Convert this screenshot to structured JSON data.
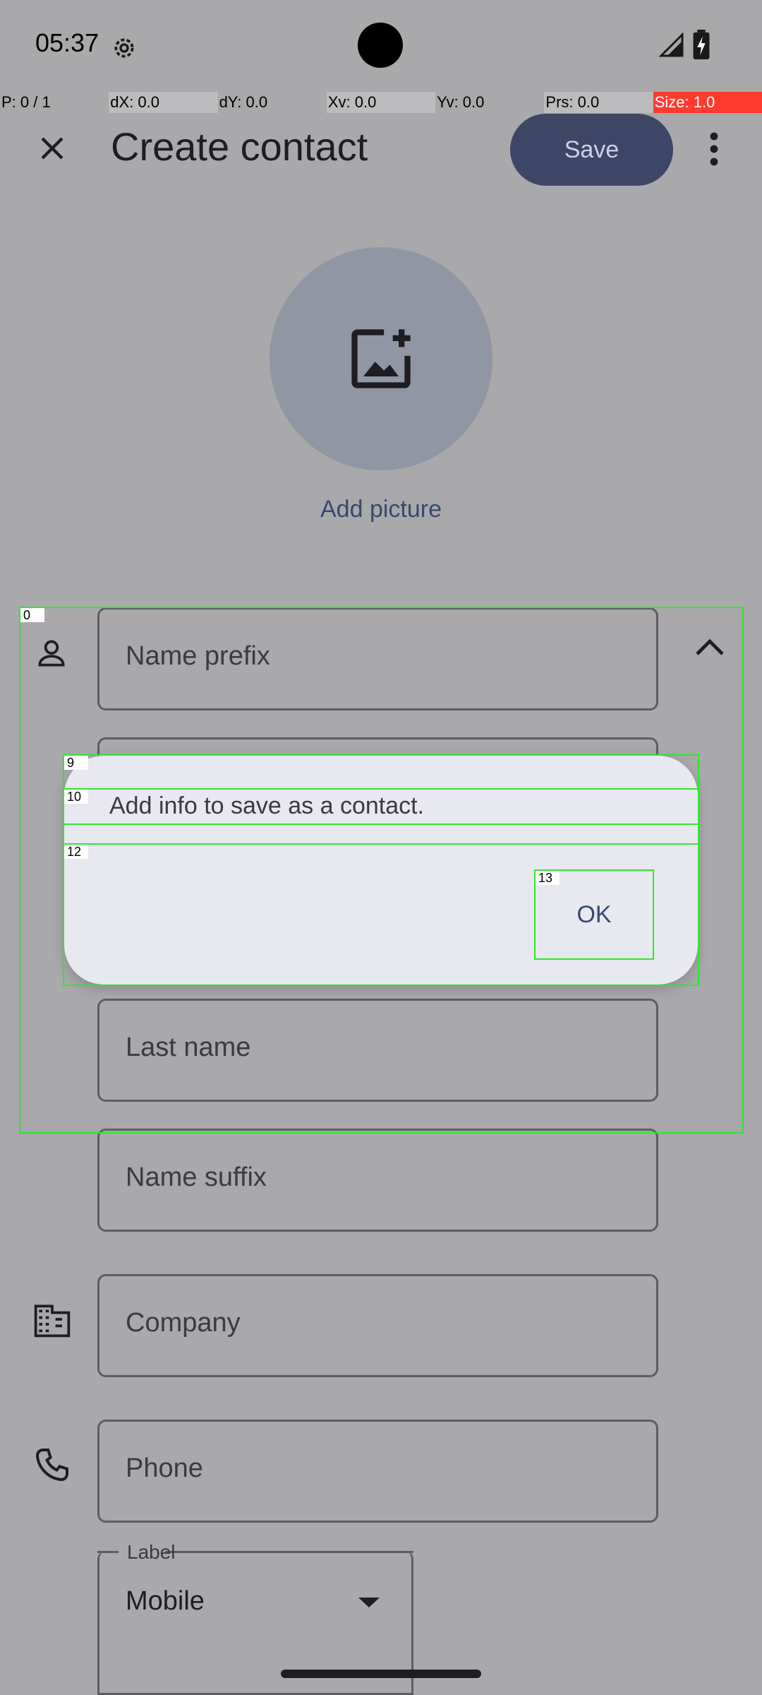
{
  "status_bar": {
    "time": "05:37"
  },
  "debug_overlay": [
    "P: 0 / 1",
    "dX: 0.0",
    "dY: 0.0",
    "Xv: 0.0",
    "Yv: 0.0",
    "Prs: 0.0",
    "Size: 1.0"
  ],
  "app_bar": {
    "title": "Create contact",
    "save_label": "Save"
  },
  "avatar": {
    "add_picture_label": "Add picture"
  },
  "fields": {
    "name_prefix": "Name prefix",
    "last_name": "Last name",
    "name_suffix": "Name suffix",
    "company": "Company",
    "phone": "Phone"
  },
  "phone_label": {
    "caption": "Label",
    "value": "Mobile"
  },
  "dialog": {
    "message": "Add info to save as a contact.",
    "ok_label": "OK"
  },
  "highlight_tags": [
    "0",
    "9",
    "10",
    "12",
    "13"
  ],
  "colors": {
    "save_bg": "#3d4664",
    "accent_text": "#3a4870",
    "highlight": "#2ee82e"
  }
}
